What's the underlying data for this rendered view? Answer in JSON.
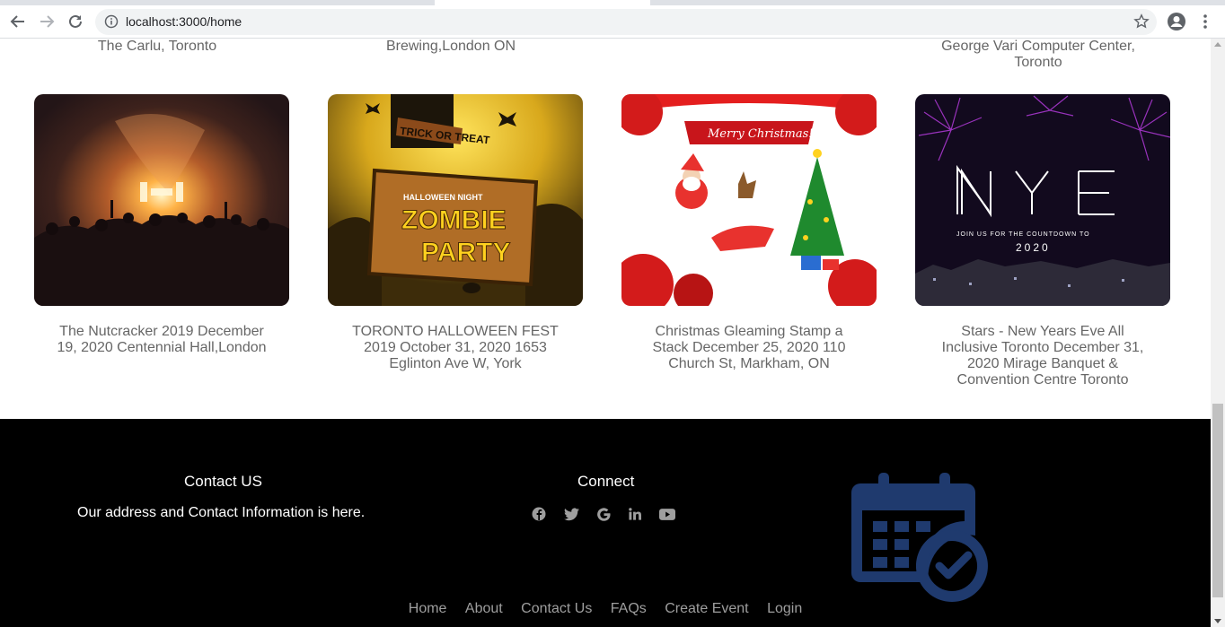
{
  "browser": {
    "url": "localhost:3000/home"
  },
  "previous_row": [
    {
      "caption": "The Carlu, Toronto"
    },
    {
      "caption": "Brewing,London ON"
    },
    {
      "caption": ""
    },
    {
      "caption": "George Vari Computer Center, Toronto"
    }
  ],
  "events": [
    {
      "caption": "The Nutcracker 2019 December 19, 2020 Centennial Hall,London",
      "image": "concert crowd"
    },
    {
      "caption": "TORONTO HALLOWEEN FEST 2019 October 31, 2020 1653 Eglinton Ave W, York",
      "image": "zombie party poster",
      "image_text": [
        "TRICK OR TREAT",
        "HALLOWEEN NIGHT",
        "ZOMBIE",
        "PARTY"
      ]
    },
    {
      "caption": "Christmas Gleaming Stamp a Stack December 25, 2020 110 Church St, Markham, ON",
      "image": "christmas card",
      "image_text": [
        "Merry Christmas!"
      ]
    },
    {
      "caption": "Stars - New Years Eve All Inclusive Toronto December 31, 2020 Mirage Banquet & Convention Centre Toronto",
      "image": "fireworks city",
      "image_text": [
        "NYE",
        "JOIN US FOR THE COUNTDOWN TO",
        "2020"
      ]
    }
  ],
  "footer": {
    "contact_title": "Contact US",
    "contact_text": "Our address and Contact Information is here.",
    "connect_title": "Connect",
    "social_icons": [
      "facebook-icon",
      "twitter-icon",
      "google-icon",
      "linkedin-icon",
      "youtube-icon"
    ],
    "links": [
      "Home",
      "About",
      "Contact Us",
      "FAQs",
      "Create Event",
      "Login"
    ]
  },
  "colors": {
    "footer_bg": "#000000",
    "caption_text": "#666666",
    "link_text": "#9e9e9e",
    "calendar_blue": "#1f3a6e"
  }
}
